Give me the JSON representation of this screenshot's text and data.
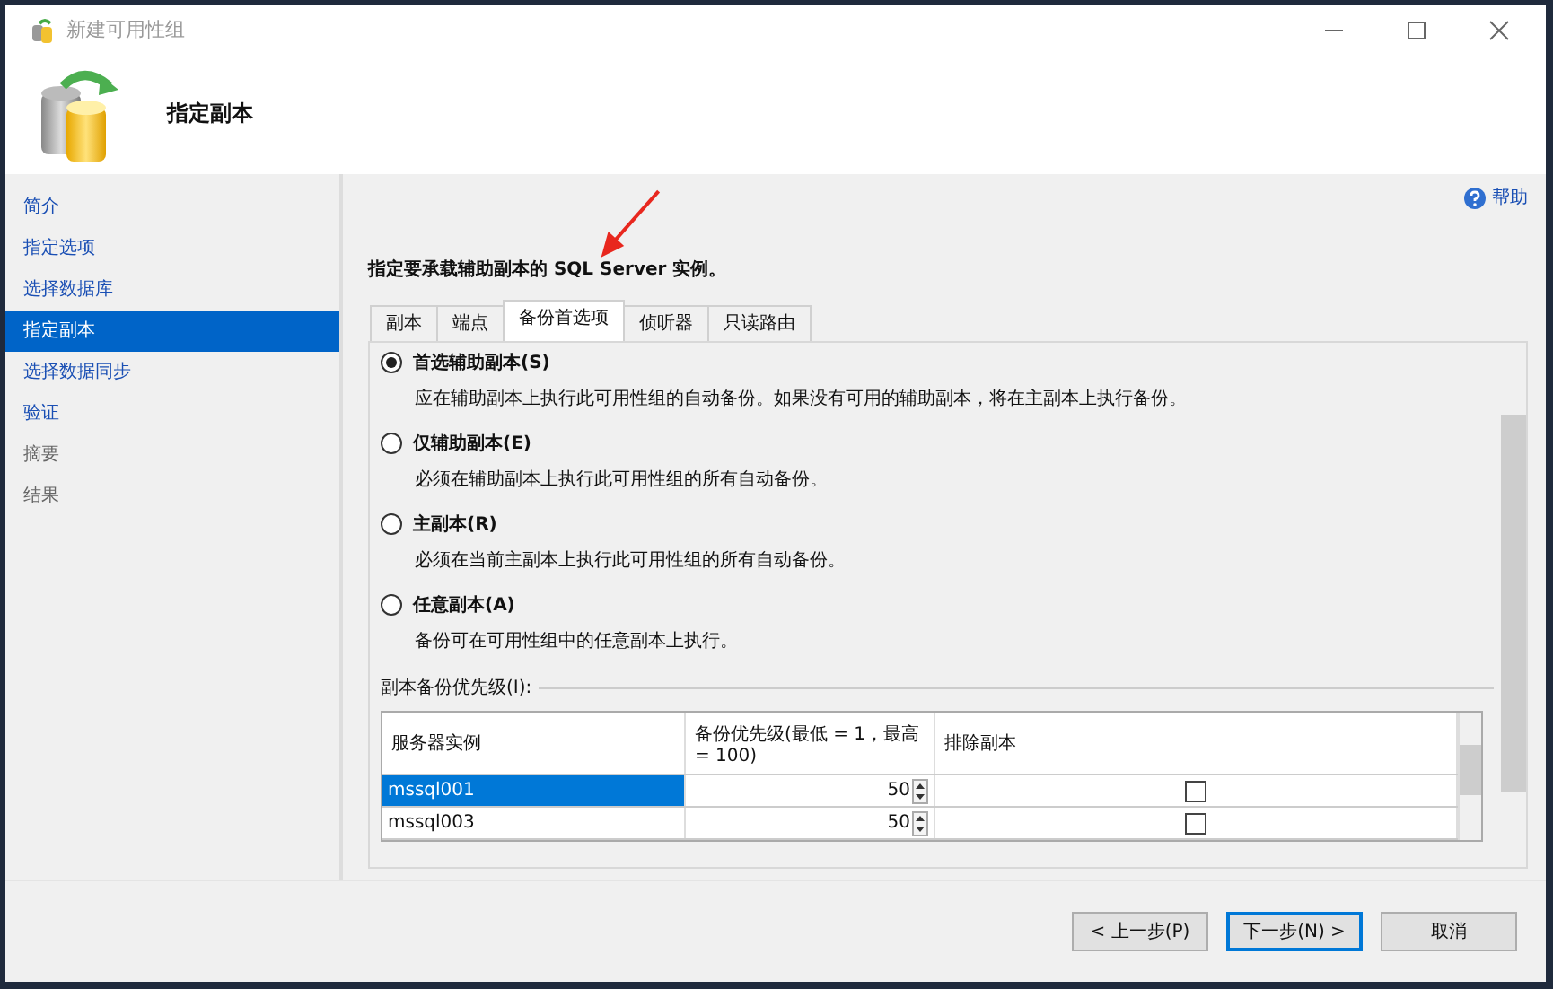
{
  "window": {
    "title": "新建可用性组"
  },
  "header": {
    "title": "指定副本"
  },
  "sidebar": {
    "items": [
      {
        "label": "简介",
        "selected": false,
        "disabled": false
      },
      {
        "label": "指定选项",
        "selected": false,
        "disabled": false
      },
      {
        "label": "选择数据库",
        "selected": false,
        "disabled": false
      },
      {
        "label": "指定副本",
        "selected": true,
        "disabled": false
      },
      {
        "label": "选择数据同步",
        "selected": false,
        "disabled": false
      },
      {
        "label": "验证",
        "selected": false,
        "disabled": false
      },
      {
        "label": "摘要",
        "selected": false,
        "disabled": true
      },
      {
        "label": "结果",
        "selected": false,
        "disabled": true
      }
    ]
  },
  "help": "帮助",
  "instruction": "指定要承载辅助副本的 SQL Server 实例。",
  "tabs": [
    {
      "label": "副本",
      "selected": false
    },
    {
      "label": "端点",
      "selected": false
    },
    {
      "label": "备份首选项",
      "selected": true
    },
    {
      "label": "侦听器",
      "selected": false
    },
    {
      "label": "只读路由",
      "selected": false
    }
  ],
  "backup_options": [
    {
      "label": "首选辅助副本(S)",
      "description": "应在辅助副本上执行此可用性组的自动备份。如果没有可用的辅助副本，将在主副本上执行备份。",
      "selected": true
    },
    {
      "label": "仅辅助副本(E)",
      "description": "必须在辅助副本上执行此可用性组的所有自动备份。",
      "selected": false
    },
    {
      "label": "主副本(R)",
      "description": "必须在当前主副本上执行此可用性组的所有自动备份。",
      "selected": false
    },
    {
      "label": "任意副本(A)",
      "description": "备份可在可用性组中的任意副本上执行。",
      "selected": false
    }
  ],
  "priority_group": {
    "label": "副本备份优先级(I):",
    "columns": [
      "服务器实例",
      "备份优先级(最低 = 1，最高 = 100)",
      "排除副本"
    ],
    "rows": [
      {
        "server": "mssql001",
        "priority": "50",
        "excluded": false,
        "selected": true
      },
      {
        "server": "mssql003",
        "priority": "50",
        "excluded": false,
        "selected": false
      }
    ]
  },
  "buttons": [
    {
      "label": "< 上一步(P)",
      "default": false
    },
    {
      "label": "下一步(N) >",
      "default": true
    },
    {
      "label": "取消",
      "default": false
    }
  ]
}
